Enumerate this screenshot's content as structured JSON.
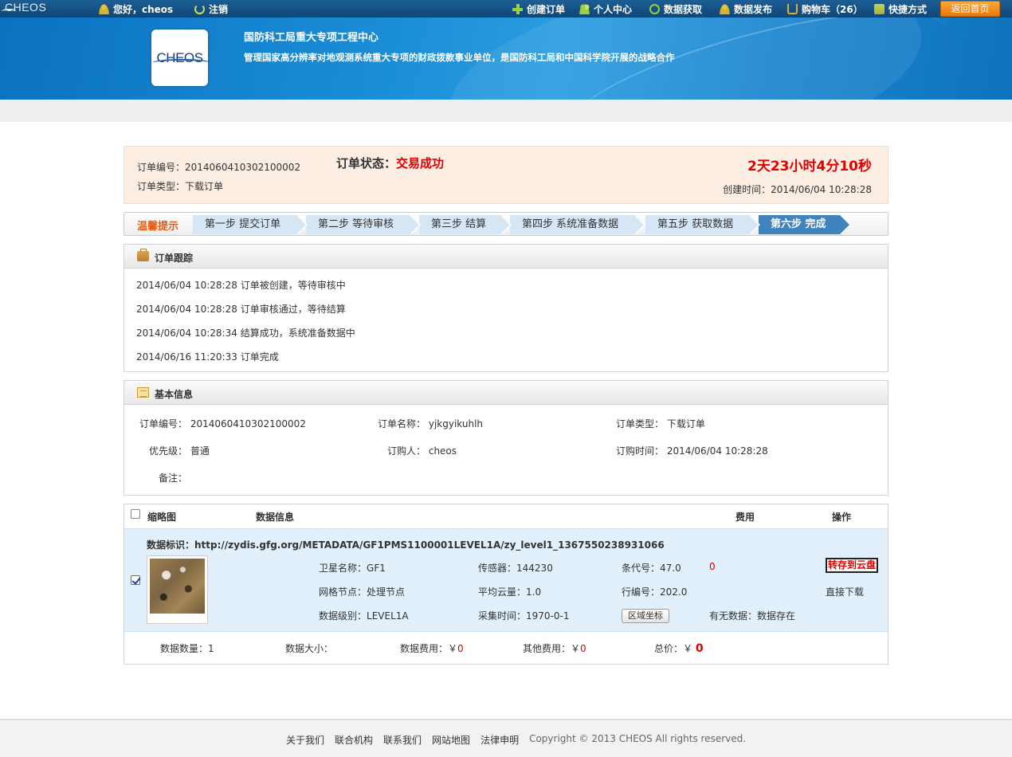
{
  "topbar": {
    "logo": "CHEOS",
    "greeting": "您好，cheos",
    "logout": "注销",
    "nav": [
      "创建订单",
      "个人中心",
      "数据获取",
      "数据发布",
      "购物车（26）",
      "快捷方式"
    ],
    "home_button": "返回首页"
  },
  "banner": {
    "logo": "CHEOS",
    "title": "国防科工局重大专项工程中心",
    "subtitle": "管理国家高分辨率对地观测系统重大专项的财政拨款事业单位，是国防科工局和中国科学院开展的战略合作"
  },
  "status": {
    "order_no_label": "订单编号：",
    "order_no": "2014060410302100002",
    "order_type_label": "订单类型：",
    "order_type": "下载订单",
    "status_label": "订单状态：",
    "status_value": "交易成功",
    "timer": "2天23小时4分10秒",
    "created_label": "创建时间：",
    "created": "2014/06/04 10:28:28"
  },
  "steps": {
    "tip": "温馨提示",
    "items": [
      "第一步 提交订单",
      "第二步 等待审核",
      "第三步 结算",
      "第四步 系统准备数据",
      "第五步 获取数据",
      "第六步 完成"
    ],
    "active_index": 5
  },
  "tracking": {
    "title": "订单跟踪",
    "entries": [
      "2014/06/04 10:28:28 订单被创建，等待审核中",
      "2014/06/04 10:28:28 订单审核通过，等待结算",
      "2014/06/04 10:28:34 结算成功，系统准备数据中",
      "2014/06/16 11:20:33 订单完成"
    ]
  },
  "basic": {
    "title": "基本信息",
    "order_no_label": "订单编号：",
    "order_no": "2014060410302100002",
    "order_name_label": "订单名称：",
    "order_name": "yjkgyikuhlh",
    "order_type_label": "订单类型：",
    "order_type": "下载订单",
    "priority_label": "优先级：",
    "priority": "普通",
    "buyer_label": "订购人：",
    "buyer": "cheos",
    "order_time_label": "订购时间：",
    "order_time": "2014/06/04 10:28:28",
    "remark_label": "备注："
  },
  "data_table": {
    "headers": {
      "thumb": "缩略图",
      "info": "数据信息",
      "fee": "费用",
      "op": "操作"
    },
    "row": {
      "checked": true,
      "id_label": "数据标识：",
      "id": "http://zydis.gfg.org/METADATA/GF1PMS1100001LEVEL1A/zy_level1_1367550238931066",
      "satellite_label": "卫星名称：",
      "satellite": "GF1",
      "sensor_label": "传感器：",
      "sensor": "144230",
      "strip_label": "条代号：",
      "strip": "47.0",
      "fee": "0",
      "grid_label": "网格节点：",
      "grid": "处理节点",
      "cloud_label": "平均云量：",
      "cloud": "1.0",
      "row_label": "行编号：",
      "row_no": "202.0",
      "level_label": "数据级别：",
      "level": "LEVEL1A",
      "acq_label": "采集时间：",
      "acq": "1970-0-1",
      "area_button": "区域坐标",
      "exists_label": "有无数据：",
      "exists": "数据存在",
      "cloud_button": "转存到云盘",
      "download": "直接下载"
    },
    "summary": {
      "count_label": "数据数量：",
      "count": "1",
      "size_label": "数据大小：",
      "fee_label": "数据费用：",
      "fee": "0",
      "other_label": "其他费用：",
      "other": "0",
      "total_label": "总价：",
      "total": "0",
      "currency": "￥"
    }
  },
  "footer": {
    "links": [
      "关于我们",
      "联合机构",
      "联系我们",
      "网站地图",
      "法律申明"
    ],
    "copyright": "Copyright © 2013 CHEOS All rights reserved."
  }
}
